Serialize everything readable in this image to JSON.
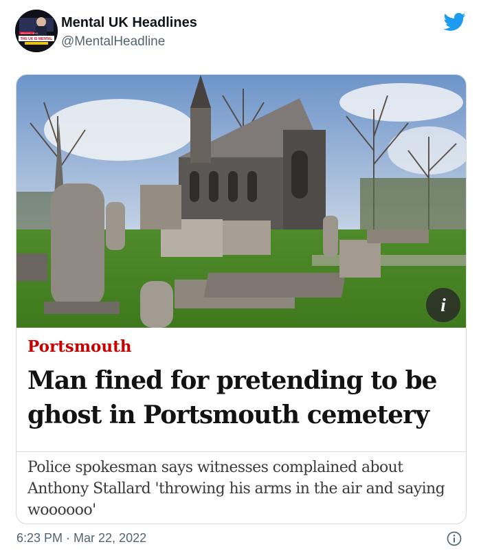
{
  "tweet": {
    "author": {
      "display_name": "Mental UK Headlines",
      "handle": "@MentalHeadline",
      "avatar_banner": "THE UK IS MENTAL",
      "avatar_badge": "BREAKING NEWS"
    },
    "logo_icon": "twitter-bird-icon",
    "card": {
      "info_label": "i",
      "kicker": "Portsmouth",
      "headline": "Man fined for pretending to be ghost in Portsmouth cemetery",
      "standfirst": "Police spokesman says witnesses complained about Anthony Stallard 'throwing his arms in the air and saying woooooo'"
    },
    "timestamp": "6:23 PM · Mar 22, 2022",
    "info_icon": "info-circle-icon"
  },
  "colors": {
    "twitter_blue": "#1d9bf0",
    "kicker_red": "#c70000",
    "muted_text": "#536471"
  }
}
